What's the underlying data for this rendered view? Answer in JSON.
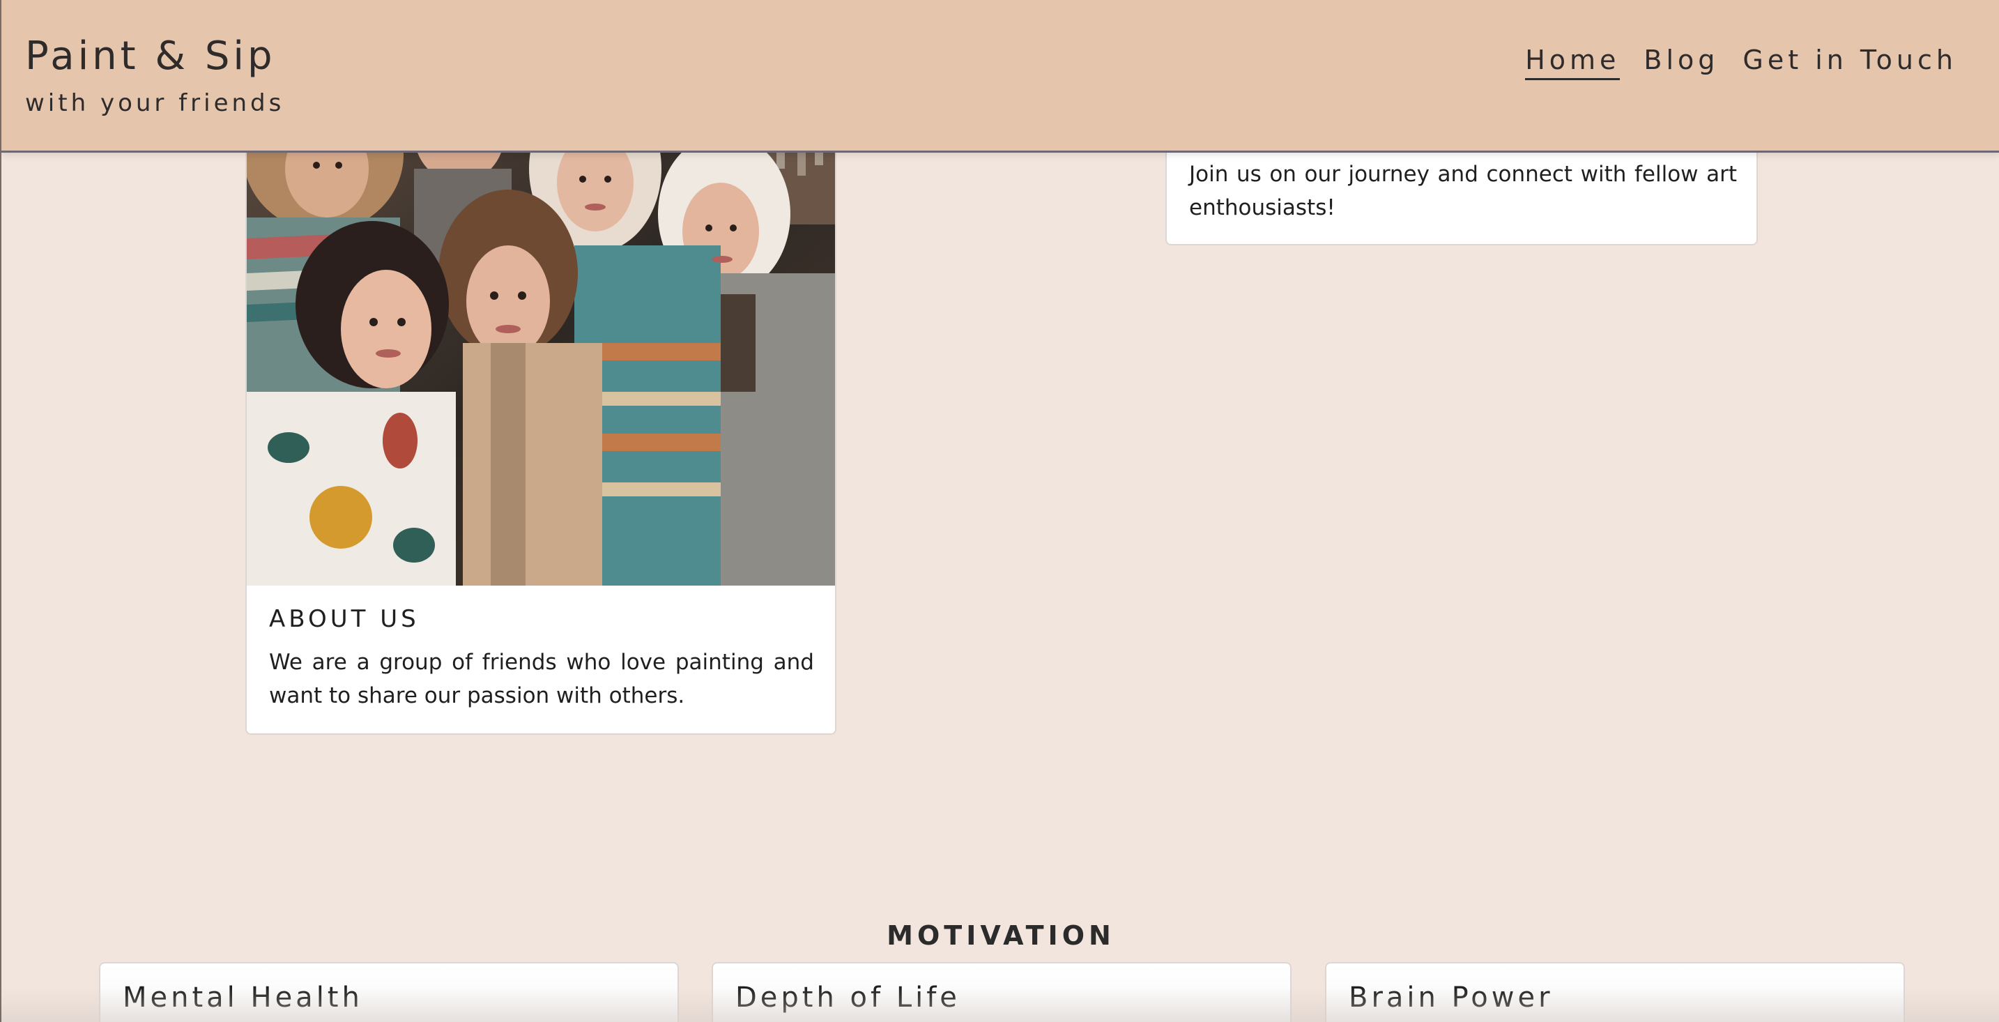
{
  "header": {
    "brand_title": "Paint & Sip",
    "brand_subtitle": "with your friends",
    "nav": {
      "home": "Home",
      "blog": "Blog",
      "contact": "Get in Touch"
    }
  },
  "about": {
    "image_icon": "friends-group-photo",
    "title": "ABOUT US",
    "text": "We are a group of friends who love painting and want to share our passion with others."
  },
  "join": {
    "text": "Join us on our journey and connect with fellow art enthousiasts!"
  },
  "motivation": {
    "heading": "MOTIVATION",
    "cards": [
      {
        "title": "Mental Health"
      },
      {
        "title": "Depth of Life"
      },
      {
        "title": "Brain Power"
      }
    ]
  },
  "colors": {
    "header_bg": "#e5c6ad",
    "page_bg": "#f2e5dd",
    "text": "#2f2b2b"
  }
}
